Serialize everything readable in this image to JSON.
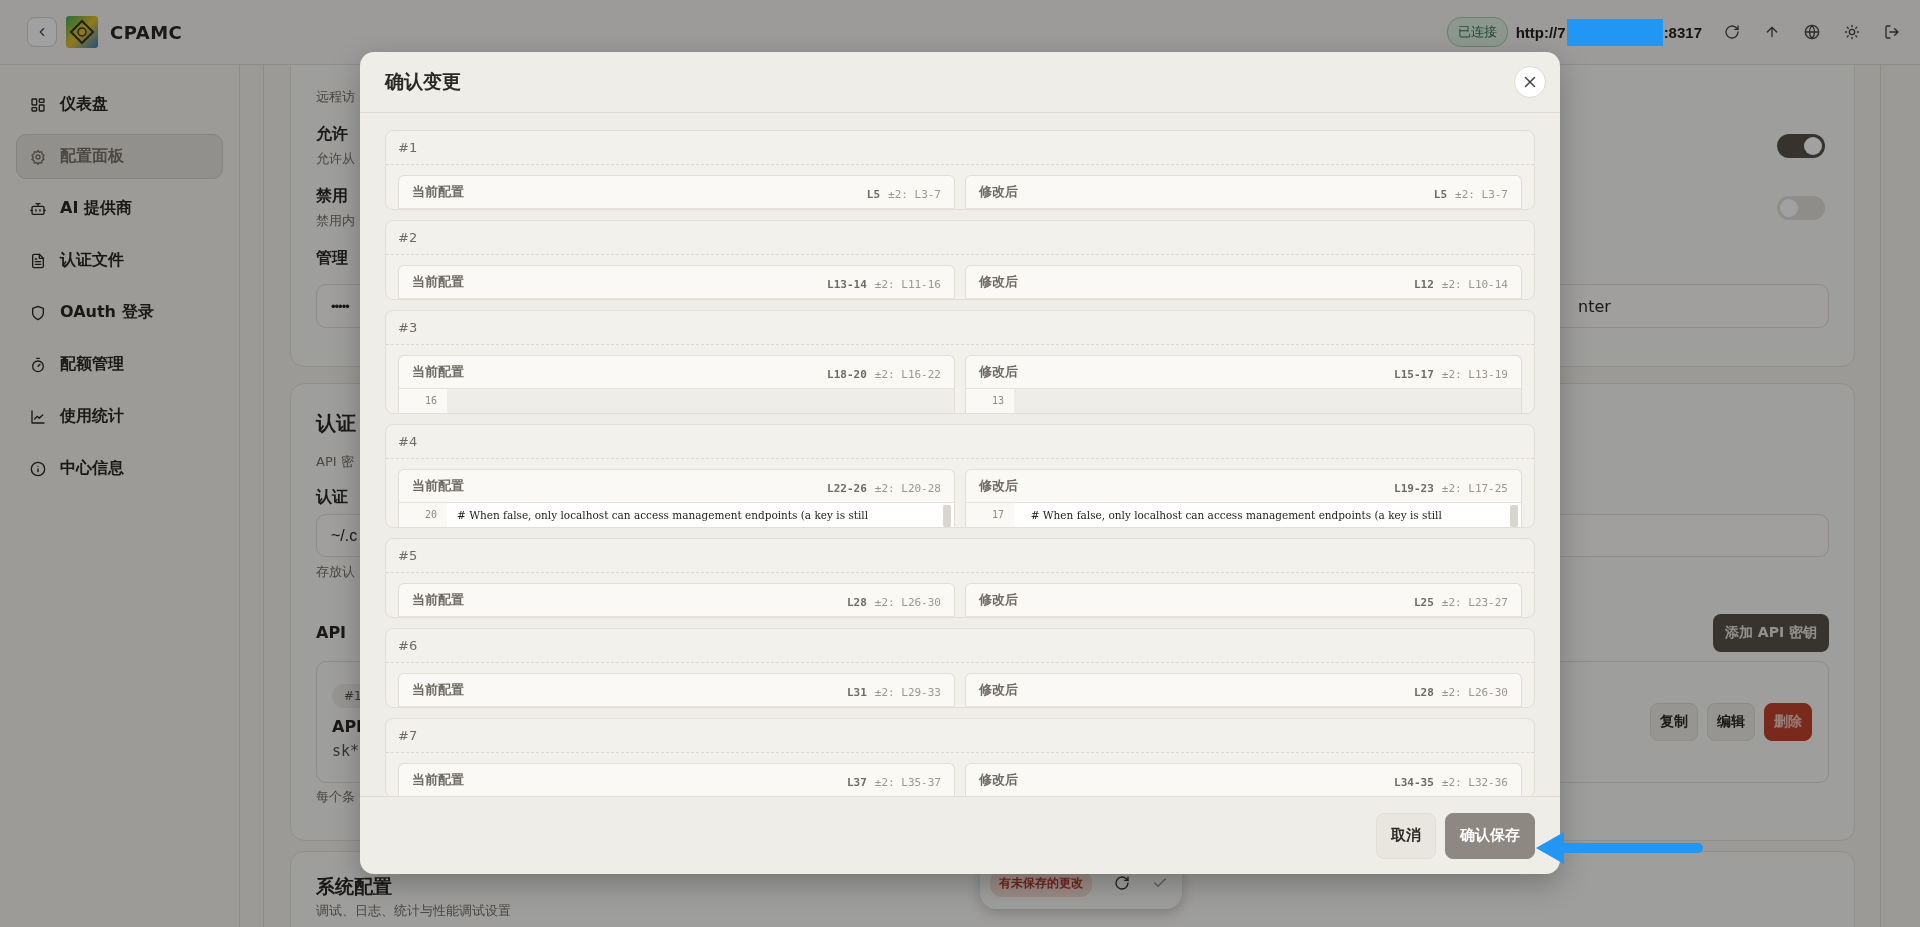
{
  "header": {
    "brand": "CPAMC",
    "status": "已连接",
    "url_start": "http://7",
    "url_end": ":8317"
  },
  "sidebar": {
    "items": [
      {
        "label": "仪表盘",
        "selected": false
      },
      {
        "label": "配置面板",
        "selected": true
      },
      {
        "label": "AI 提供商",
        "selected": false
      },
      {
        "label": "认证文件",
        "selected": false
      },
      {
        "label": "OAuth 登录",
        "selected": false
      },
      {
        "label": "配额管理",
        "selected": false
      },
      {
        "label": "使用统计",
        "selected": false
      },
      {
        "label": "中心信息",
        "selected": false
      }
    ]
  },
  "remote_card": {
    "subtitle": "远程访",
    "settings": [
      {
        "label": "允许",
        "description": "允许从",
        "on": true
      },
      {
        "label": "禁用",
        "description": "禁用内",
        "on": false
      }
    ],
    "key_label": "管理",
    "key_value": "•••••",
    "key_tail": "nter"
  },
  "auth_card": {
    "title": "认证",
    "subtitle": "API 密",
    "file_label": "认证",
    "file_value": "~/.c",
    "file_hint": "存放认",
    "keys_label": "API",
    "add_button": "添加 API 密钥",
    "key_entry": {
      "index": "#1",
      "name": "API",
      "value": "sk*",
      "actions": [
        {
          "label": "复制",
          "kind": "plain"
        },
        {
          "label": "编辑",
          "kind": "plain"
        },
        {
          "label": "删除",
          "kind": "danger"
        }
      ]
    },
    "footnote": "每个条"
  },
  "system_card": {
    "title": "系统配置",
    "subtitle": "调试、日志、统计与性能调试设置"
  },
  "save_bar": {
    "badge": "有未保存的更改"
  },
  "dialog": {
    "title": "确认变更",
    "hunks": [
      {
        "label": "#1",
        "before": {
          "title": "当前配置",
          "range": "L5",
          "context": "±2: L3-7"
        },
        "after": {
          "title": "修改后",
          "range": "L5",
          "context": "±2: L3-7"
        }
      },
      {
        "label": "#2",
        "before": {
          "title": "当前配置",
          "range": "L13-14",
          "context": "±2: L11-16"
        },
        "after": {
          "title": "修改后",
          "range": "L12",
          "context": "±2: L10-14"
        }
      },
      {
        "label": "#3",
        "before": {
          "title": "当前配置",
          "range": "L18-20",
          "context": "±2: L16-22",
          "lines": [
            {
              "number": "16"
            }
          ]
        },
        "after": {
          "title": "修改后",
          "range": "L15-17",
          "context": "±2: L13-19",
          "lines": [
            {
              "number": "13"
            }
          ]
        }
      },
      {
        "label": "#4",
        "before": {
          "title": "当前配置",
          "range": "L22-26",
          "context": "±2: L20-28",
          "lines": [
            {
              "number": "20",
              "code": "# When false, only localhost can access management endpoints (a key is still"
            }
          ]
        },
        "after": {
          "title": "修改后",
          "range": "L19-23",
          "context": "±2: L17-25",
          "lines": [
            {
              "number": "17",
              "code": "  # When false, only localhost can access management endpoints (a key is still"
            }
          ]
        }
      },
      {
        "label": "#5",
        "before": {
          "title": "当前配置",
          "range": "L28",
          "context": "±2: L26-30"
        },
        "after": {
          "title": "修改后",
          "range": "L25",
          "context": "±2: L23-27"
        }
      },
      {
        "label": "#6",
        "before": {
          "title": "当前配置",
          "range": "L31",
          "context": "±2: L29-33"
        },
        "after": {
          "title": "修改后",
          "range": "L28",
          "context": "±2: L26-30"
        }
      },
      {
        "label": "#7",
        "before": {
          "title": "当前配置",
          "range": "L37",
          "context": "±2: L35-37"
        },
        "after": {
          "title": "修改后",
          "range": "L34-35",
          "context": "±2: L32-36"
        }
      }
    ],
    "buttons": [
      {
        "label": "取消",
        "kind": "secondary"
      },
      {
        "label": "确认保存",
        "kind": "primary"
      }
    ]
  }
}
